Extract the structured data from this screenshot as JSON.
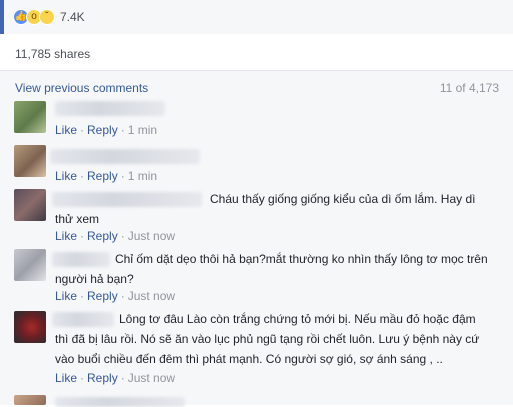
{
  "reactions": {
    "icons": [
      "like-icon",
      "wow-icon",
      "sad-icon"
    ],
    "count": "7.4K"
  },
  "shares": "11,785 shares",
  "comments_header": {
    "view_previous": "View previous comments",
    "pager": "11 of 4,173"
  },
  "action_labels": {
    "like": "Like",
    "reply": "Reply",
    "sep": "·"
  },
  "comments": [
    {
      "text_lines": [],
      "time": "1 min"
    },
    {
      "text_lines": [],
      "time": "1 min"
    },
    {
      "text_lines": [
        "Cháu thấy giống giống kiểu của dì ốm lắm. Hay dì",
        "thử xem"
      ],
      "time": "Just now"
    },
    {
      "text_lines": [
        "Chỉ ốm dặt dẹo thôi hả bạn?mắt thường ko nhìn thấy lông tơ mọc trên",
        "người hả bạn?"
      ],
      "time": "Just now"
    },
    {
      "text_lines": [
        "Lông tơ đâu Lào còn trắng chứng tỏ mới bị. Nếu mầu đỏ hoặc đậm",
        "thì đã bị lâu rồi. Nó sẽ ăn vào lục phủ ngũ tạng rồi chết luôn. Lưu ý bệnh này cứ",
        "vào buổi chiều đến đêm thì phát mạnh. Có người sợ gió, sợ ánh sáng , .."
      ],
      "time": "Just now"
    }
  ],
  "colors": {
    "link": "#365899",
    "meta": "#90949c",
    "accent": "#4267b2"
  }
}
